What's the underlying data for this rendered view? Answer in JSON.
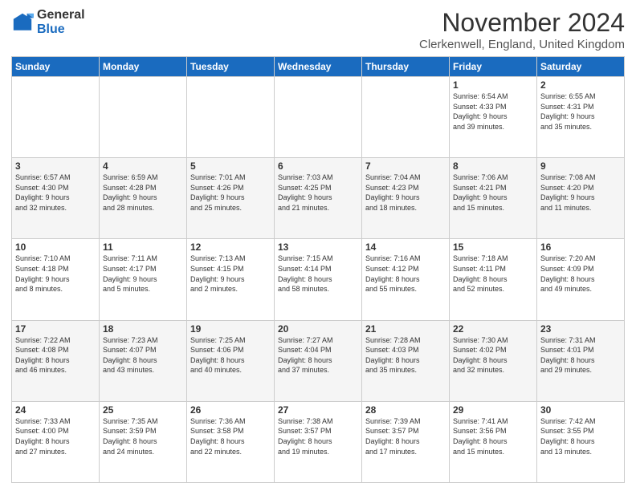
{
  "header": {
    "logo_general": "General",
    "logo_blue": "Blue",
    "month_title": "November 2024",
    "location": "Clerkenwell, England, United Kingdom"
  },
  "days_of_week": [
    "Sunday",
    "Monday",
    "Tuesday",
    "Wednesday",
    "Thursday",
    "Friday",
    "Saturday"
  ],
  "weeks": [
    [
      {
        "day": "",
        "info": ""
      },
      {
        "day": "",
        "info": ""
      },
      {
        "day": "",
        "info": ""
      },
      {
        "day": "",
        "info": ""
      },
      {
        "day": "",
        "info": ""
      },
      {
        "day": "1",
        "info": "Sunrise: 6:54 AM\nSunset: 4:33 PM\nDaylight: 9 hours\nand 39 minutes."
      },
      {
        "day": "2",
        "info": "Sunrise: 6:55 AM\nSunset: 4:31 PM\nDaylight: 9 hours\nand 35 minutes."
      }
    ],
    [
      {
        "day": "3",
        "info": "Sunrise: 6:57 AM\nSunset: 4:30 PM\nDaylight: 9 hours\nand 32 minutes."
      },
      {
        "day": "4",
        "info": "Sunrise: 6:59 AM\nSunset: 4:28 PM\nDaylight: 9 hours\nand 28 minutes."
      },
      {
        "day": "5",
        "info": "Sunrise: 7:01 AM\nSunset: 4:26 PM\nDaylight: 9 hours\nand 25 minutes."
      },
      {
        "day": "6",
        "info": "Sunrise: 7:03 AM\nSunset: 4:25 PM\nDaylight: 9 hours\nand 21 minutes."
      },
      {
        "day": "7",
        "info": "Sunrise: 7:04 AM\nSunset: 4:23 PM\nDaylight: 9 hours\nand 18 minutes."
      },
      {
        "day": "8",
        "info": "Sunrise: 7:06 AM\nSunset: 4:21 PM\nDaylight: 9 hours\nand 15 minutes."
      },
      {
        "day": "9",
        "info": "Sunrise: 7:08 AM\nSunset: 4:20 PM\nDaylight: 9 hours\nand 11 minutes."
      }
    ],
    [
      {
        "day": "10",
        "info": "Sunrise: 7:10 AM\nSunset: 4:18 PM\nDaylight: 9 hours\nand 8 minutes."
      },
      {
        "day": "11",
        "info": "Sunrise: 7:11 AM\nSunset: 4:17 PM\nDaylight: 9 hours\nand 5 minutes."
      },
      {
        "day": "12",
        "info": "Sunrise: 7:13 AM\nSunset: 4:15 PM\nDaylight: 9 hours\nand 2 minutes."
      },
      {
        "day": "13",
        "info": "Sunrise: 7:15 AM\nSunset: 4:14 PM\nDaylight: 8 hours\nand 58 minutes."
      },
      {
        "day": "14",
        "info": "Sunrise: 7:16 AM\nSunset: 4:12 PM\nDaylight: 8 hours\nand 55 minutes."
      },
      {
        "day": "15",
        "info": "Sunrise: 7:18 AM\nSunset: 4:11 PM\nDaylight: 8 hours\nand 52 minutes."
      },
      {
        "day": "16",
        "info": "Sunrise: 7:20 AM\nSunset: 4:09 PM\nDaylight: 8 hours\nand 49 minutes."
      }
    ],
    [
      {
        "day": "17",
        "info": "Sunrise: 7:22 AM\nSunset: 4:08 PM\nDaylight: 8 hours\nand 46 minutes."
      },
      {
        "day": "18",
        "info": "Sunrise: 7:23 AM\nSunset: 4:07 PM\nDaylight: 8 hours\nand 43 minutes."
      },
      {
        "day": "19",
        "info": "Sunrise: 7:25 AM\nSunset: 4:06 PM\nDaylight: 8 hours\nand 40 minutes."
      },
      {
        "day": "20",
        "info": "Sunrise: 7:27 AM\nSunset: 4:04 PM\nDaylight: 8 hours\nand 37 minutes."
      },
      {
        "day": "21",
        "info": "Sunrise: 7:28 AM\nSunset: 4:03 PM\nDaylight: 8 hours\nand 35 minutes."
      },
      {
        "day": "22",
        "info": "Sunrise: 7:30 AM\nSunset: 4:02 PM\nDaylight: 8 hours\nand 32 minutes."
      },
      {
        "day": "23",
        "info": "Sunrise: 7:31 AM\nSunset: 4:01 PM\nDaylight: 8 hours\nand 29 minutes."
      }
    ],
    [
      {
        "day": "24",
        "info": "Sunrise: 7:33 AM\nSunset: 4:00 PM\nDaylight: 8 hours\nand 27 minutes."
      },
      {
        "day": "25",
        "info": "Sunrise: 7:35 AM\nSunset: 3:59 PM\nDaylight: 8 hours\nand 24 minutes."
      },
      {
        "day": "26",
        "info": "Sunrise: 7:36 AM\nSunset: 3:58 PM\nDaylight: 8 hours\nand 22 minutes."
      },
      {
        "day": "27",
        "info": "Sunrise: 7:38 AM\nSunset: 3:57 PM\nDaylight: 8 hours\nand 19 minutes."
      },
      {
        "day": "28",
        "info": "Sunrise: 7:39 AM\nSunset: 3:57 PM\nDaylight: 8 hours\nand 17 minutes."
      },
      {
        "day": "29",
        "info": "Sunrise: 7:41 AM\nSunset: 3:56 PM\nDaylight: 8 hours\nand 15 minutes."
      },
      {
        "day": "30",
        "info": "Sunrise: 7:42 AM\nSunset: 3:55 PM\nDaylight: 8 hours\nand 13 minutes."
      }
    ]
  ]
}
